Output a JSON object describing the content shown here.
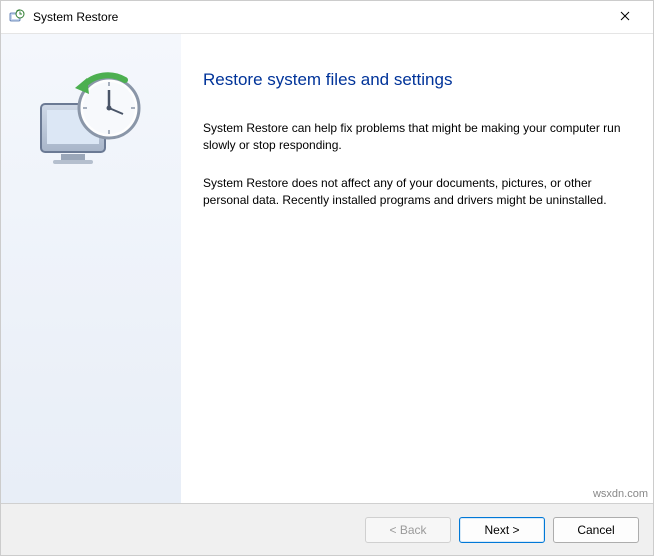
{
  "titlebar": {
    "title": "System Restore"
  },
  "main": {
    "heading": "Restore system files and settings",
    "paragraph1": "System Restore can help fix problems that might be making your computer run slowly or stop responding.",
    "paragraph2": "System Restore does not affect any of your documents, pictures, or other personal data. Recently installed programs and drivers might be uninstalled."
  },
  "footer": {
    "back_label": "< Back",
    "next_label": "Next >",
    "cancel_label": "Cancel"
  },
  "watermark": "wsxdn.com"
}
